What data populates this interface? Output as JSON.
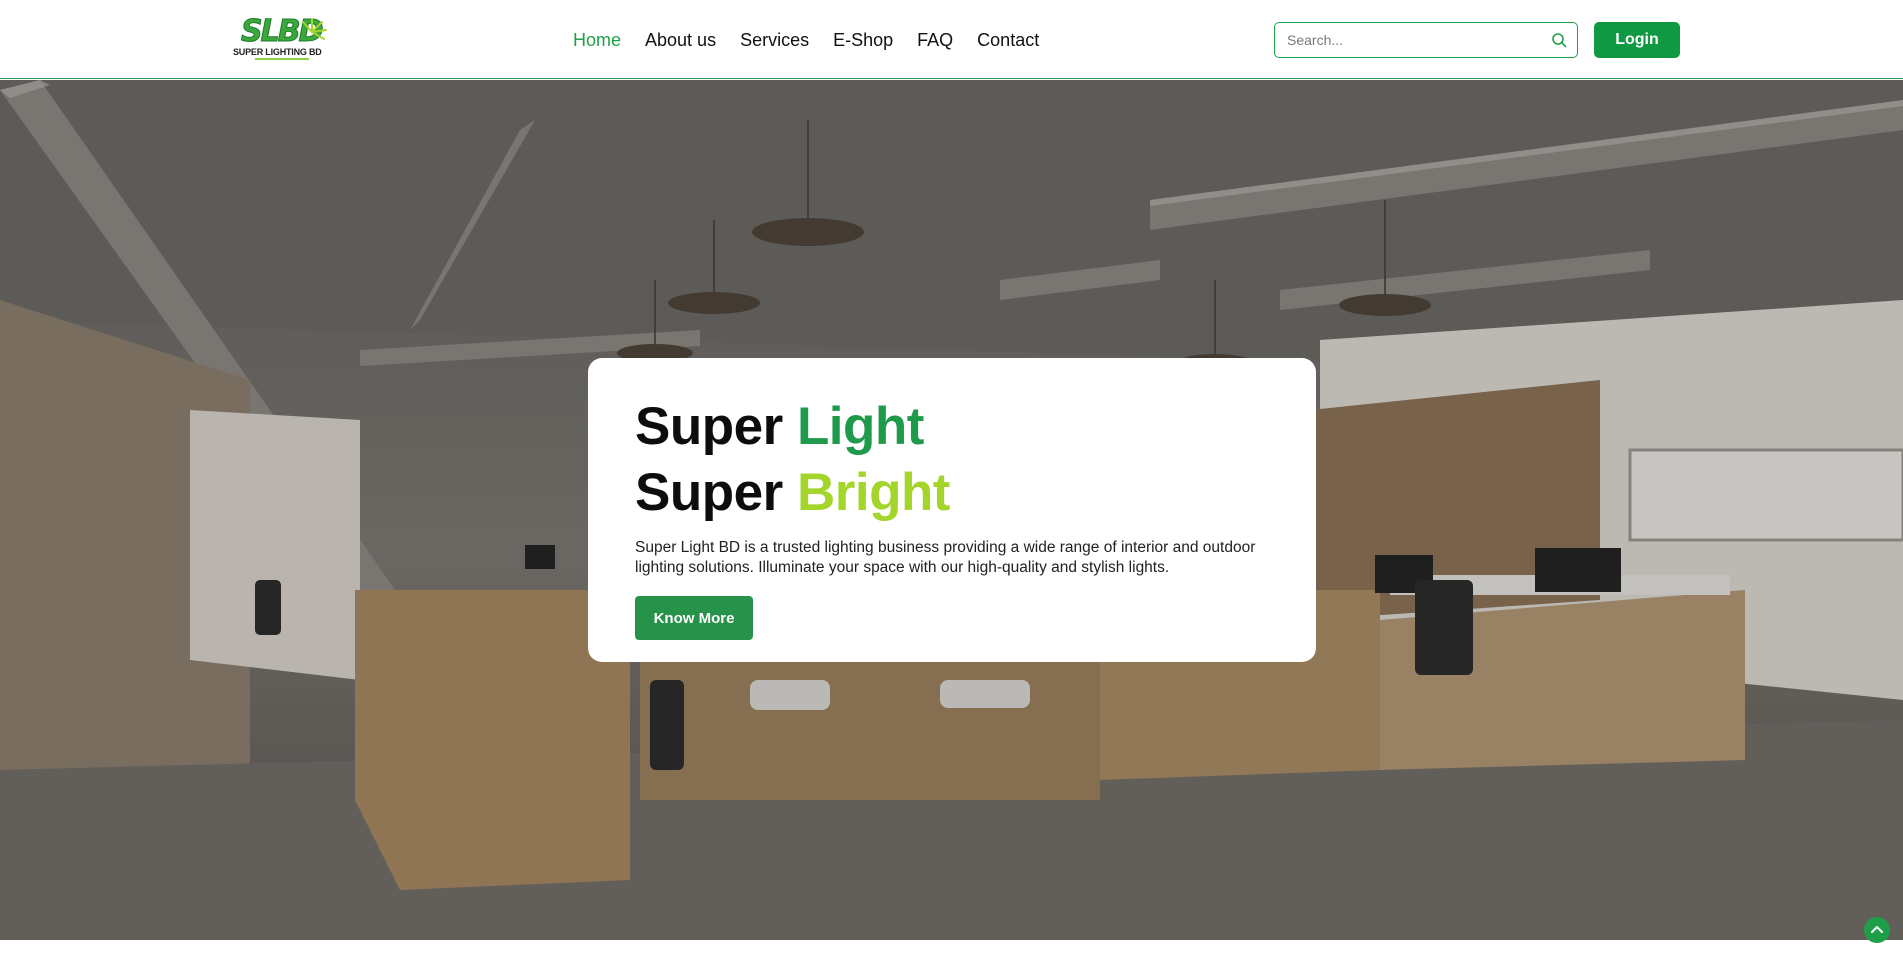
{
  "brand": {
    "logo_mark": "SLBD",
    "logo_text": "SUPER LIGHTING BD",
    "colors": {
      "primary": "#1ea14a",
      "accent_lime": "#a3d52b",
      "button": "#109842"
    }
  },
  "nav": {
    "items": [
      {
        "label": "Home",
        "active": true
      },
      {
        "label": "About us",
        "active": false
      },
      {
        "label": "Services",
        "active": false
      },
      {
        "label": "E-Shop",
        "active": false
      },
      {
        "label": "FAQ",
        "active": false
      },
      {
        "label": "Contact",
        "active": false
      }
    ]
  },
  "search": {
    "placeholder": "Search...",
    "value": "",
    "icon": "search-icon"
  },
  "login": {
    "label": "Login"
  },
  "hero": {
    "line1_word1": "Super",
    "line1_word2": "Light",
    "line2_word1": "Super",
    "line2_word2": "Bright",
    "description": "Super Light BD is a trusted lighting business providing a wide range of interior and outdoor lighting solutions. Illuminate your space with our high-quality and stylish lights.",
    "cta_label": "Know More"
  },
  "scroll_top": {
    "icon": "chevron-up-icon"
  }
}
